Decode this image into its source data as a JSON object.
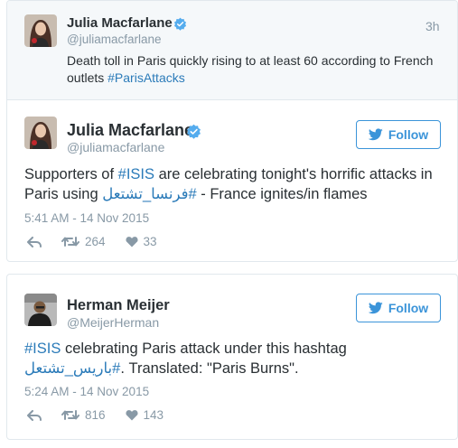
{
  "quoted_tweet": {
    "author_name": "Julia Macfarlane",
    "handle": "@juliamacfarlane",
    "time_ago": "3h",
    "text_plain": "Death toll in Paris quickly rising to at least 60 according to French outlets ",
    "hashtag": "#ParisAttacks",
    "avatar_icon": "profile-photo"
  },
  "tweets": [
    {
      "author_name": "Julia Macfarlane",
      "handle": "@juliamacfarlane",
      "follow_label": "Follow",
      "text_pre": "Supporters of ",
      "hashtag1": "#ISIS",
      "text_mid": " are celebrating tonight's horrific attacks in Paris using ",
      "hashtag2": "#فرنسا_تشتعل",
      "text_post": " - France ignites/in flames",
      "timestamp": "5:41 AM - 14 Nov 2015",
      "retweets": "264",
      "likes": "33"
    },
    {
      "author_name": "Herman Meijer",
      "handle": "@MeijerHerman",
      "follow_label": "Follow",
      "hashtag1": "#ISIS",
      "text_mid": " celebrating Paris attack under this hashtag ",
      "hashtag2": "#باريس_تشتعل",
      "text_post": ". Translated: \"Paris Burns\".",
      "timestamp": "5:24 AM - 14 Nov 2015",
      "retweets": "816",
      "likes": "143"
    }
  ],
  "colors": {
    "link": "#2b7bb9",
    "follow": "#3b94d9",
    "verified": "#55acee",
    "muted": "#8899a6",
    "quoted_bg": "#f5f8fa",
    "border": "#e1e8ed"
  }
}
